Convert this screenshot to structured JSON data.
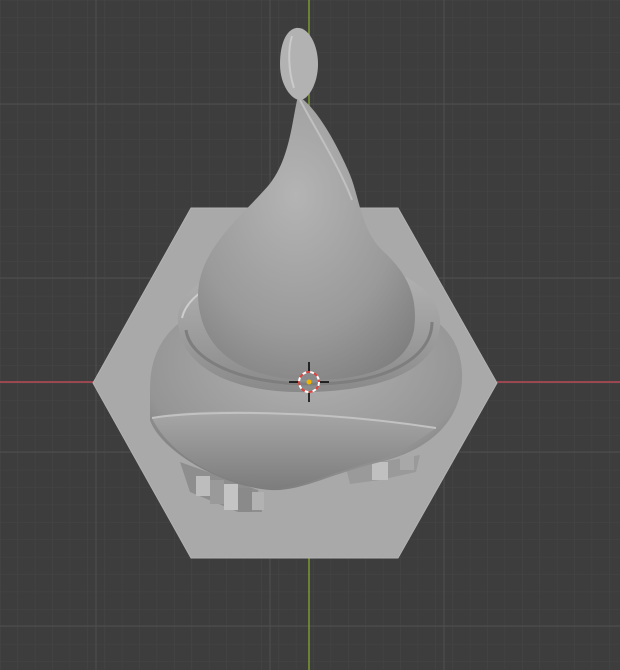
{
  "viewport": {
    "background_color": "#3d3d3d",
    "grid_minor_color": "#474747",
    "grid_major_color": "#505050",
    "x_axis_color": "#b94a57",
    "y_axis_color": "#7a9a2f"
  },
  "model": {
    "base_color": "#a9a9a9",
    "body_color": "#9c9c9c",
    "body_shadow_color": "#6f6f6f",
    "highlight_color": "#c9c9c9"
  },
  "cursor": {
    "icon": "3d-cursor-icon",
    "ring_color_a": "#e0443e",
    "ring_color_b": "#ffffff",
    "center_color": "#f0b400"
  }
}
